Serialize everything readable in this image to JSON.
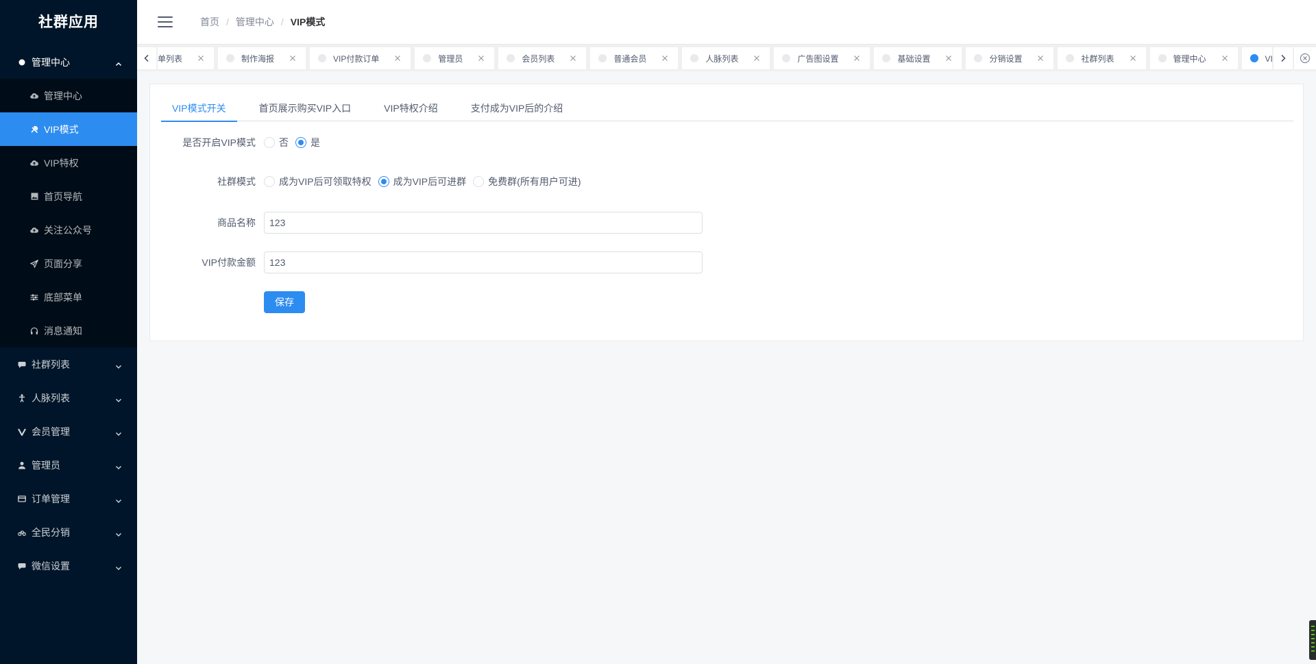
{
  "sidebar": {
    "logo": "社群应用",
    "groups": [
      {
        "label": "管理中心",
        "icon": "circle-icon",
        "open": true
      },
      {
        "label": "社群列表",
        "icon": "chat-icon"
      },
      {
        "label": "人脉列表",
        "icon": "person-icon"
      },
      {
        "label": "会员管理",
        "icon": "v-icon"
      },
      {
        "label": "管理员",
        "icon": "user-icon"
      },
      {
        "label": "订单管理",
        "icon": "card-icon"
      },
      {
        "label": "全民分销",
        "icon": "bicycle-icon"
      },
      {
        "label": "微信设置",
        "icon": "chat-icon"
      }
    ],
    "sub_items": [
      {
        "label": "管理中心",
        "icon": "cloud-upload-icon"
      },
      {
        "label": "VIP模式",
        "icon": "tools-icon",
        "active": true
      },
      {
        "label": "VIP特权",
        "icon": "cloud-upload-icon"
      },
      {
        "label": "首页导航",
        "icon": "image-icon"
      },
      {
        "label": "关注公众号",
        "icon": "cloud-upload-icon"
      },
      {
        "label": "页面分享",
        "icon": "send-icon"
      },
      {
        "label": "底部菜单",
        "icon": "sliders-icon"
      },
      {
        "label": "消息通知",
        "icon": "headphones-icon"
      }
    ]
  },
  "header": {
    "breadcrumb": [
      "首页",
      "管理中心",
      "VIP模式"
    ]
  },
  "tags": [
    {
      "label": "订单列表"
    },
    {
      "label": "制作海报"
    },
    {
      "label": "VIP付款订单"
    },
    {
      "label": "管理员"
    },
    {
      "label": "会员列表"
    },
    {
      "label": "普通会员"
    },
    {
      "label": "人脉列表"
    },
    {
      "label": "广告图设置"
    },
    {
      "label": "基础设置"
    },
    {
      "label": "分销设置"
    },
    {
      "label": "社群列表"
    },
    {
      "label": "管理中心"
    },
    {
      "label": "VIP模式",
      "active": true
    }
  ],
  "tabs": [
    {
      "label": "VIP模式开关",
      "active": true
    },
    {
      "label": "首页展示购买VIP入口"
    },
    {
      "label": "VIP特权介绍"
    },
    {
      "label": "支付成为VIP后的介绍"
    }
  ],
  "form": {
    "vip_enable": {
      "label": "是否开启VIP模式",
      "options": [
        "否",
        "是"
      ],
      "selected": "是"
    },
    "group_mode": {
      "label": "社群模式",
      "options": [
        "成为VIP后可领取特权",
        "成为VIP后可进群",
        "免费群(所有用户可进)"
      ],
      "selected": "成为VIP后可进群"
    },
    "product_name": {
      "label": "商品名称",
      "value": "123"
    },
    "vip_amount": {
      "label": "VIP付款金额",
      "value": "123"
    },
    "save_label": "保存"
  },
  "colors": {
    "sidebar_bg": "#001529",
    "submenu_bg": "#000c17",
    "accent": "#2d8cf0"
  }
}
